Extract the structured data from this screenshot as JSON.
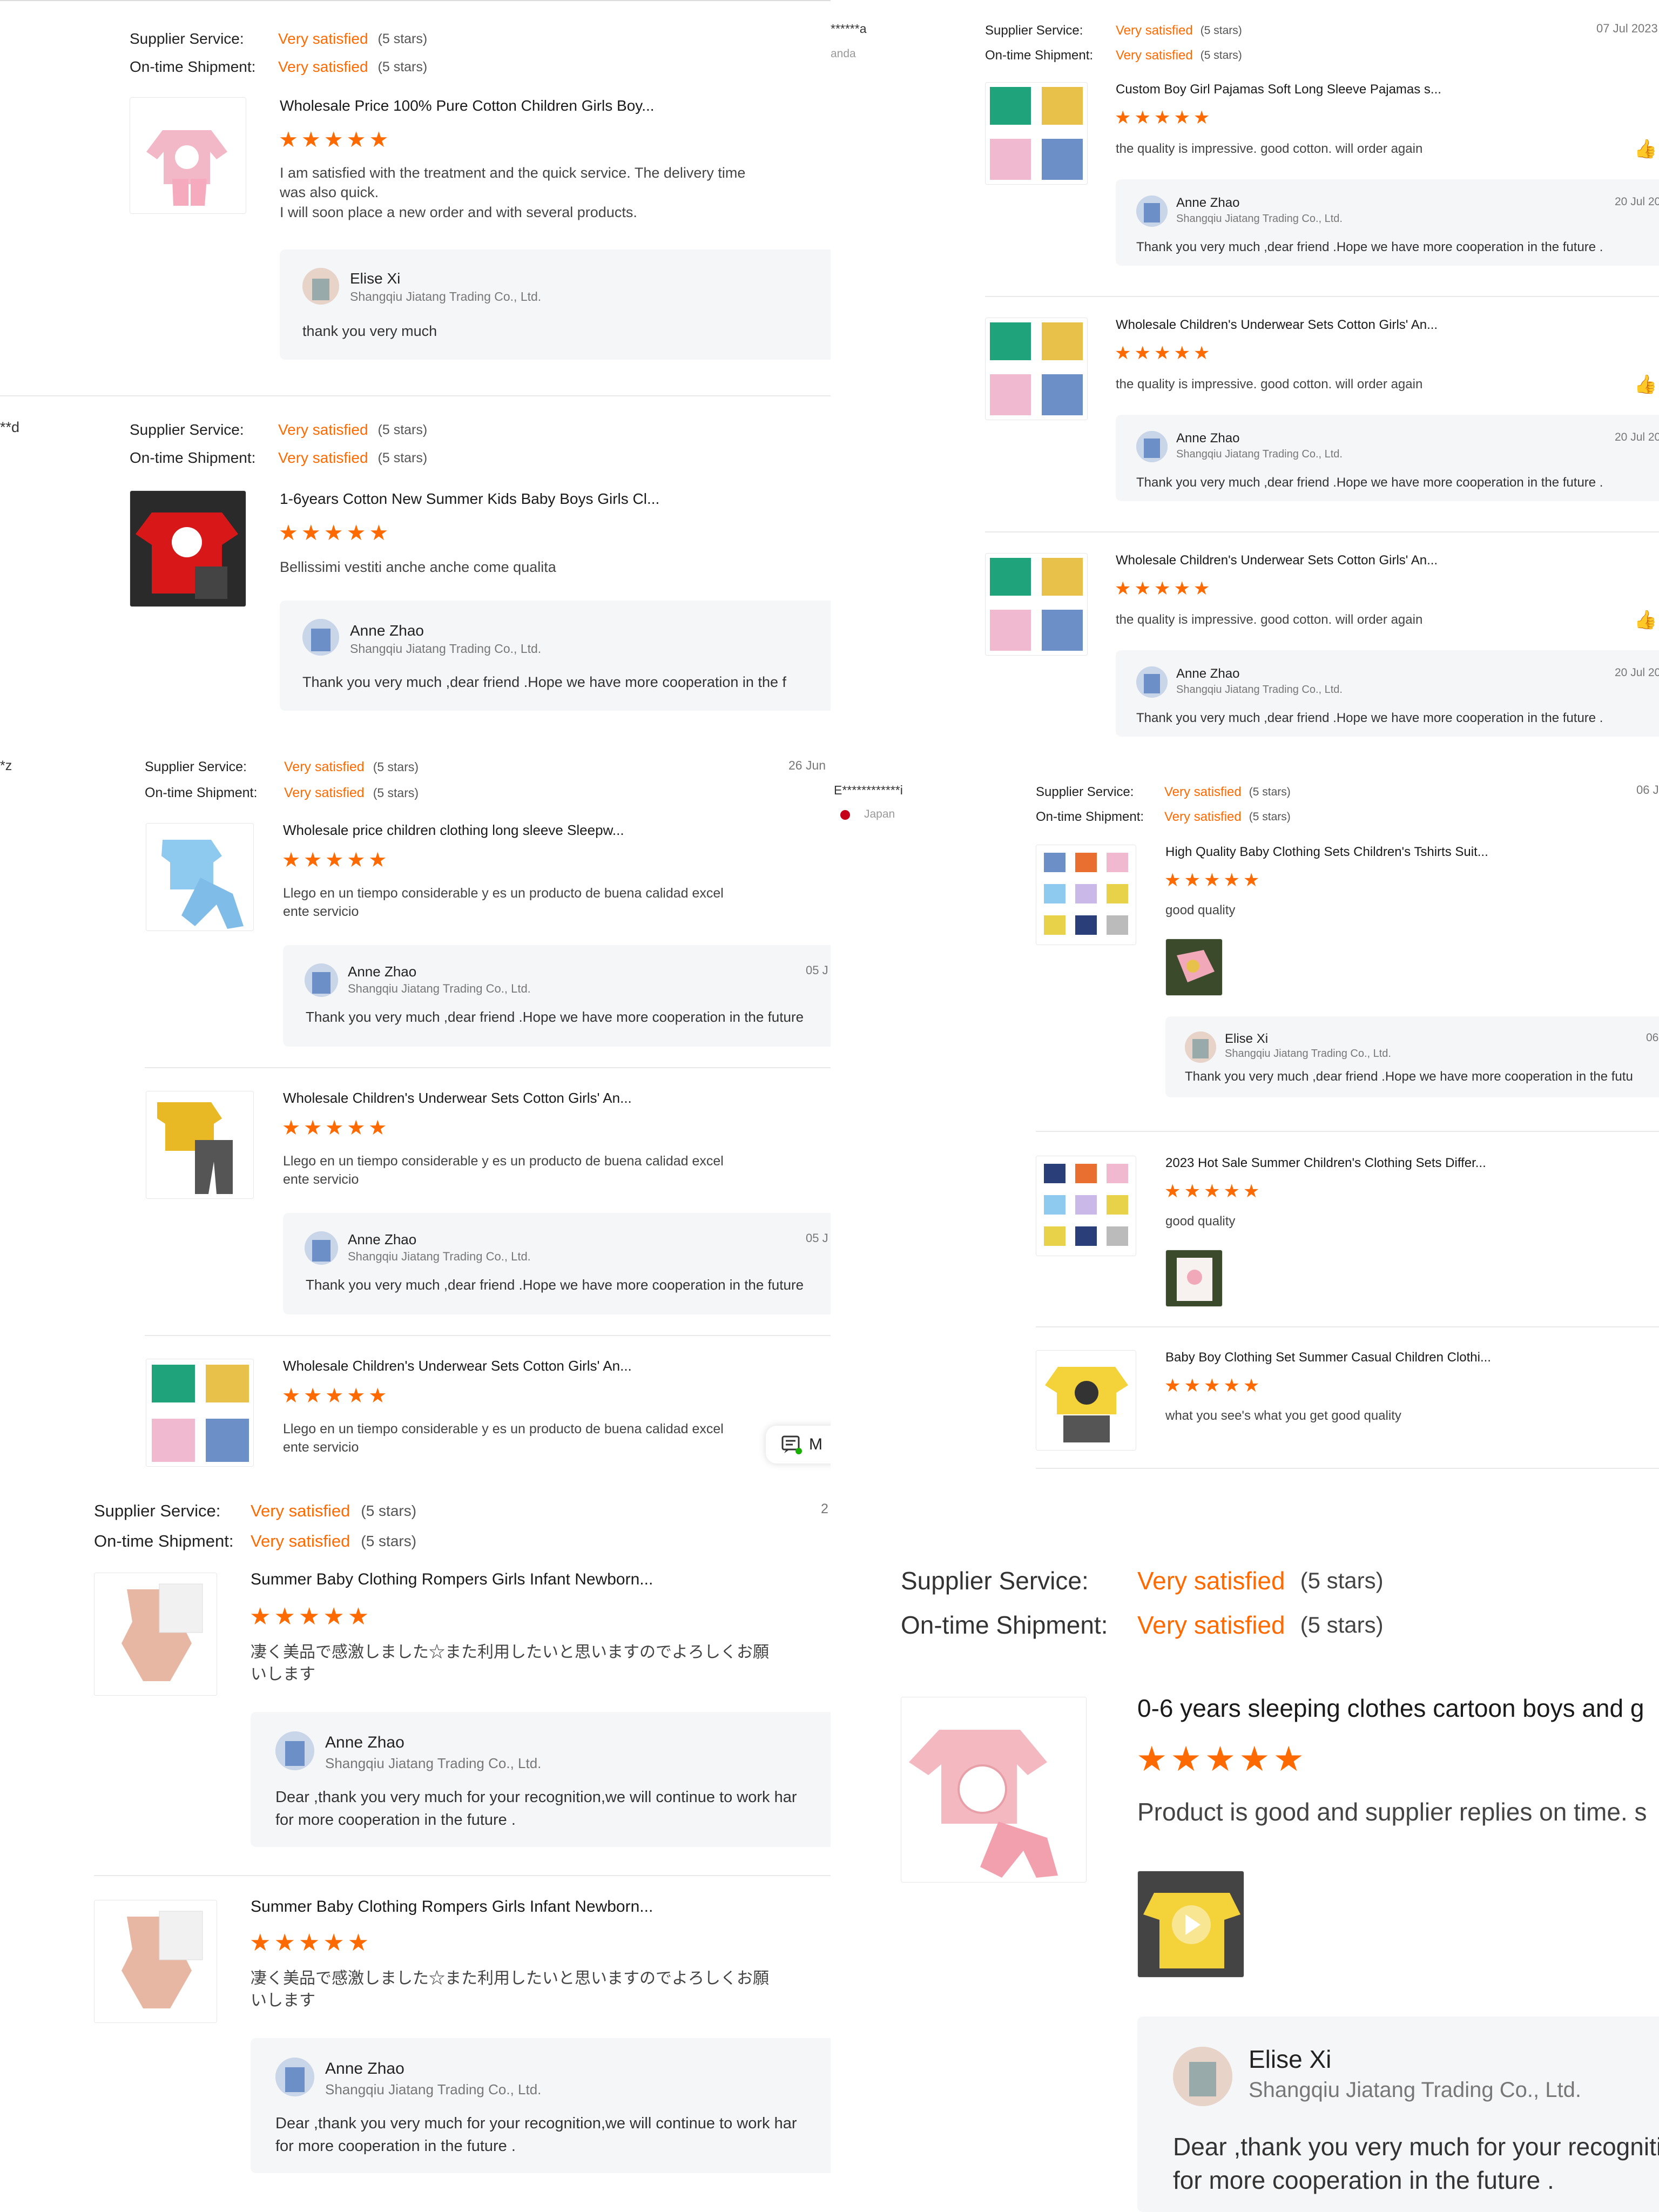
{
  "labels": {
    "supplier_service": "Supplier Service:",
    "ontime_shipment": "On-time Shipment:",
    "very_satisfied": "Very satisfied",
    "five_stars": "(5 stars)",
    "stars": "★★★★★",
    "company": "Shangqiu Jiatang Trading Co., Ltd."
  },
  "icons": {
    "like": "thumbs-up-icon",
    "chat": "chat-icon"
  },
  "colors": {
    "accent": "#ff6a00"
  },
  "p1": {
    "title": "Wholesale Price 100% Pure Cotton Children Girls Boy...",
    "comment_l1": "I am satisfied with the treatment and the quick service. The delivery time",
    "comment_l2": "was also quick.",
    "comment_l3": "I will soon place a new order and with several products.",
    "reply_name": "Elise Xi",
    "reply_text": "thank you very much"
  },
  "p2": {
    "nick": "**d",
    "title": "1-6years Cotton New Summer Kids Baby Boys Girls Cl...",
    "comment": "Bellissimi vestiti anche anche come qualita",
    "reply_name": "Anne Zhao",
    "reply_text": "Thank you very much  ,dear friend .Hope we have more cooperation in the f"
  },
  "p3": {
    "nick": "*z",
    "date": "26 Jun",
    "items": [
      {
        "title": "Wholesale price children clothing long sleeve Sleepw...",
        "comment_l1": "Llego en un tiempo considerable y es un producto de buena calidad excel",
        "comment_l2": "ente servicio",
        "reply_name": "Anne Zhao",
        "reply_date": "05 J",
        "reply_text": "Thank you very much  ,dear friend .Hope we have more cooperation in the future"
      },
      {
        "title": "Wholesale Children's Underwear Sets Cotton Girls' An...",
        "comment_l1": "Llego en un tiempo considerable y es un producto de buena calidad excel",
        "comment_l2": "ente servicio",
        "reply_name": "Anne Zhao",
        "reply_date": "05 J",
        "reply_text": "Thank you very much  ,dear friend .Hope we have more cooperation in the future"
      },
      {
        "title": "Wholesale Children's Underwear Sets Cotton Girls' An...",
        "comment_l1": "Llego en un tiempo considerable y es un producto de buena calidad excel",
        "comment_l2": "ente servicio"
      }
    ],
    "chat_label": "M"
  },
  "p4": {
    "date": "2",
    "items": [
      {
        "title": "Summer Baby Clothing Rompers Girls Infant Newborn...",
        "comment_l1": "凄く美品で感激しました☆また利用したいと思いますのでよろしくお願",
        "comment_l2": "いします",
        "reply_name": "Anne Zhao",
        "reply_l1": "Dear ,thank you very much for your recognition,we will continue to work har",
        "reply_l2": "for more cooperation in the future ."
      },
      {
        "title": "Summer Baby Clothing Rompers Girls Infant Newborn...",
        "comment_l1": "凄く美品で感激しました☆また利用したいと思いますのでよろしくお願",
        "comment_l2": "いします",
        "reply_name": "Anne Zhao",
        "reply_l1": "Dear ,thank you very much for your recognition,we will continue to work har",
        "reply_l2": "for more cooperation in the future ."
      }
    ]
  },
  "p5": {
    "nick": "******a",
    "nick2": "anda",
    "date": "07 Jul 2023",
    "items": [
      {
        "title": "Custom Boy Girl Pajamas Soft Long Sleeve Pajamas s...",
        "comment": "the quality is impressive. good cotton. will order again",
        "reply_name": "Anne Zhao",
        "reply_date": "20 Jul 20",
        "reply_text": "Thank you very much  ,dear friend .Hope we have more cooperation in the future ."
      },
      {
        "title": "Wholesale Children's Underwear Sets Cotton Girls' An...",
        "comment": "the quality is impressive. good cotton. will order again",
        "reply_name": "Anne Zhao",
        "reply_date": "20 Jul 20",
        "reply_text": "Thank you very much  ,dear friend .Hope we have more cooperation in the future ."
      },
      {
        "title": "Wholesale Children's Underwear Sets Cotton Girls' An...",
        "comment": "the quality is impressive. good cotton. will order again",
        "reply_name": "Anne Zhao",
        "reply_date": "20 Jul 20",
        "reply_text": "Thank you very much  ,dear friend .Hope we have more cooperation in the future ."
      }
    ]
  },
  "p6": {
    "nick": "E************i",
    "country": "Japan",
    "date": "06 J",
    "items": [
      {
        "title": "High Quality Baby Clothing Sets Children's Tshirts Suit...",
        "comment": "good quality",
        "reply_name": "Elise Xi",
        "reply_date": "06",
        "reply_text": "Thank you very much  ,dear friend .Hope we have more cooperation in the futu"
      },
      {
        "title": "2023 Hot Sale Summer Children's Clothing Sets Differ...",
        "comment": "good quality"
      },
      {
        "title": "Baby Boy Clothing Set Summer Casual Children Clothi...",
        "comment": "what you see's what you get good quality"
      }
    ]
  },
  "p7": {
    "title": "0-6 years sleeping clothes cartoon boys and g",
    "comment": "Product is good and supplier replies on time. s",
    "reply_name": "Elise Xi",
    "reply_l1": "Dear ,thank you very much for your recogniti",
    "reply_l2": "for more cooperation in the future ."
  }
}
